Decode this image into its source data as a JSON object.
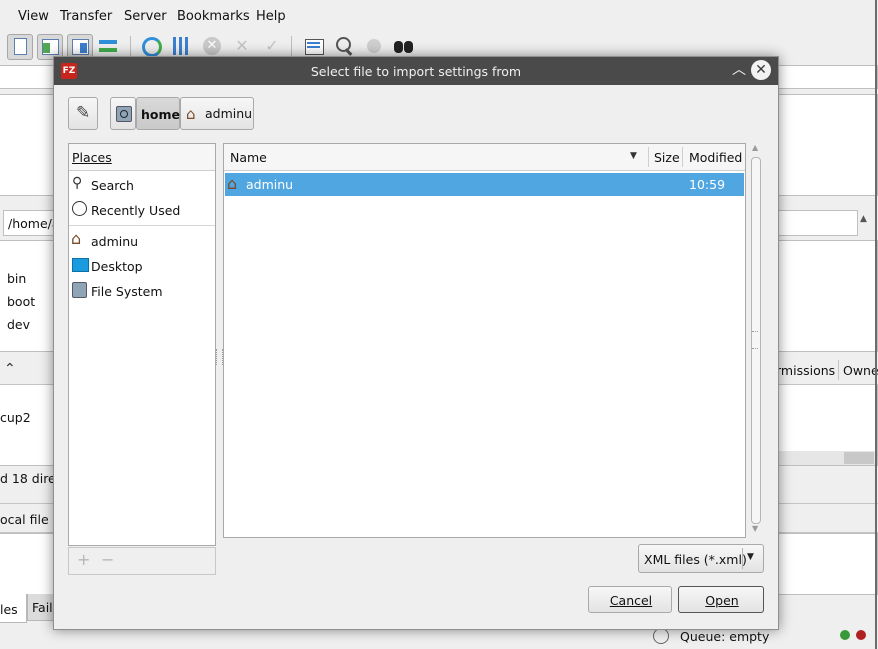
{
  "menubar": {
    "items": [
      "View",
      "Transfer",
      "Server",
      "Bookmarks",
      "Help"
    ]
  },
  "background": {
    "local_path_value": "/home/a",
    "tree_items": [
      "bin",
      "boot",
      "dev"
    ],
    "column_permissions": "rmissions",
    "column_owner": "Owne",
    "list_item": "cup2",
    "status_summary": "d 18 dire",
    "local_file_header": "ocal file",
    "tab_files": "les",
    "tab_failed": "Faile",
    "queue_status": "Queue: empty"
  },
  "dialog": {
    "title": "Select file to import settings from",
    "breadcrumb": {
      "current": "home",
      "user": "adminu"
    },
    "places": {
      "header": "Places",
      "items": [
        "Search",
        "Recently Used",
        "adminu",
        "Desktop",
        "File System"
      ],
      "add": "+",
      "remove": "−"
    },
    "files": {
      "columns": {
        "name": "Name",
        "size": "Size",
        "modified": "Modified"
      },
      "rows": [
        {
          "name": "adminu",
          "size": "",
          "modified": "10:59"
        }
      ]
    },
    "filter": {
      "selected": "XML files (*.xml)"
    },
    "buttons": {
      "cancel": "Cancel",
      "open": "Open"
    }
  },
  "colors": {
    "titlebar": "#4a4a4a",
    "selection": "#4fa6e0",
    "close_button_bg": "#f2f2f2"
  }
}
